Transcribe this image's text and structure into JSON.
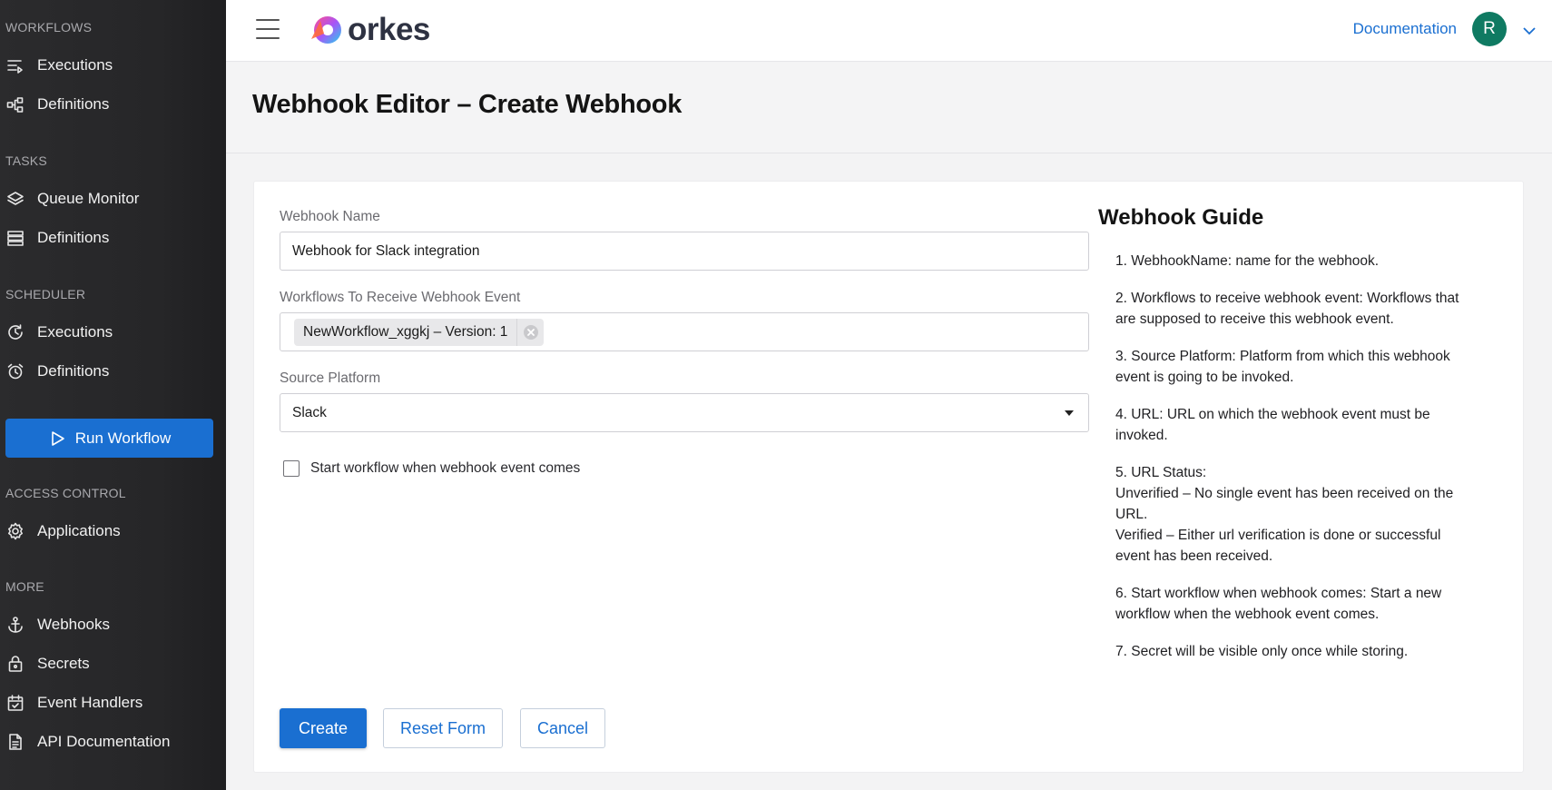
{
  "sidebar": {
    "sections": [
      {
        "label": "WORKFLOWS",
        "items": [
          {
            "label": "Executions",
            "icon": "executions-list-icon"
          },
          {
            "label": "Definitions",
            "icon": "workflow-diagram-icon"
          }
        ]
      },
      {
        "label": "TASKS",
        "items": [
          {
            "label": "Queue Monitor",
            "icon": "layers-icon"
          },
          {
            "label": "Definitions",
            "icon": "stack-icon"
          }
        ]
      },
      {
        "label": "SCHEDULER",
        "items": [
          {
            "label": "Executions",
            "icon": "refresh-clock-icon"
          },
          {
            "label": "Definitions",
            "icon": "alarm-clock-icon"
          }
        ]
      },
      {
        "label": "ACCESS CONTROL",
        "items": [
          {
            "label": "Applications",
            "icon": "gear-icon"
          }
        ]
      },
      {
        "label": "MORE",
        "items": [
          {
            "label": "Webhooks",
            "icon": "anchor-icon"
          },
          {
            "label": "Secrets",
            "icon": "lock-bag-icon"
          },
          {
            "label": "Event Handlers",
            "icon": "calendar-check-icon"
          },
          {
            "label": "API Documentation",
            "icon": "document-icon"
          }
        ]
      }
    ],
    "run_workflow_label": "Run Workflow"
  },
  "header": {
    "logo_text": "orkes",
    "documentation_label": "Documentation",
    "avatar_initial": "R"
  },
  "page": {
    "title": "Webhook Editor – Create Webhook"
  },
  "form": {
    "webhook_name_label": "Webhook Name",
    "webhook_name_value": "Webhook for Slack integration",
    "workflows_label": "Workflows To Receive Webhook Event",
    "workflow_chip": "NewWorkflow_xggkj – Version: 1",
    "source_platform_label": "Source Platform",
    "source_platform_value": "Slack",
    "start_workflow_label": "Start workflow when webhook event comes",
    "start_workflow_checked": false,
    "create_label": "Create",
    "reset_label": "Reset Form",
    "cancel_label": "Cancel"
  },
  "guide": {
    "title": "Webhook Guide",
    "items": [
      "1. WebhookName: name for the webhook.",
      "2. Workflows to receive webhook event: Workflows that are supposed to receive this webhook event.",
      "3. Source Platform: Platform from which this webhook event is going to be invoked.",
      "4. URL: URL on which the webhook event must be invoked.",
      "5. URL Status:",
      "Unverified – No single event has been received on the URL.",
      "Verified – Either url verification is done or successful event has been received.",
      "6. Start workflow when webhook comes: Start a new workflow when the webhook event comes.",
      "7. Secret will be visible only once while storing."
    ]
  },
  "colors": {
    "accent": "#1a6fd1",
    "sidebar_bg": "#2b2b2d",
    "avatar_bg": "#0f7a62"
  }
}
